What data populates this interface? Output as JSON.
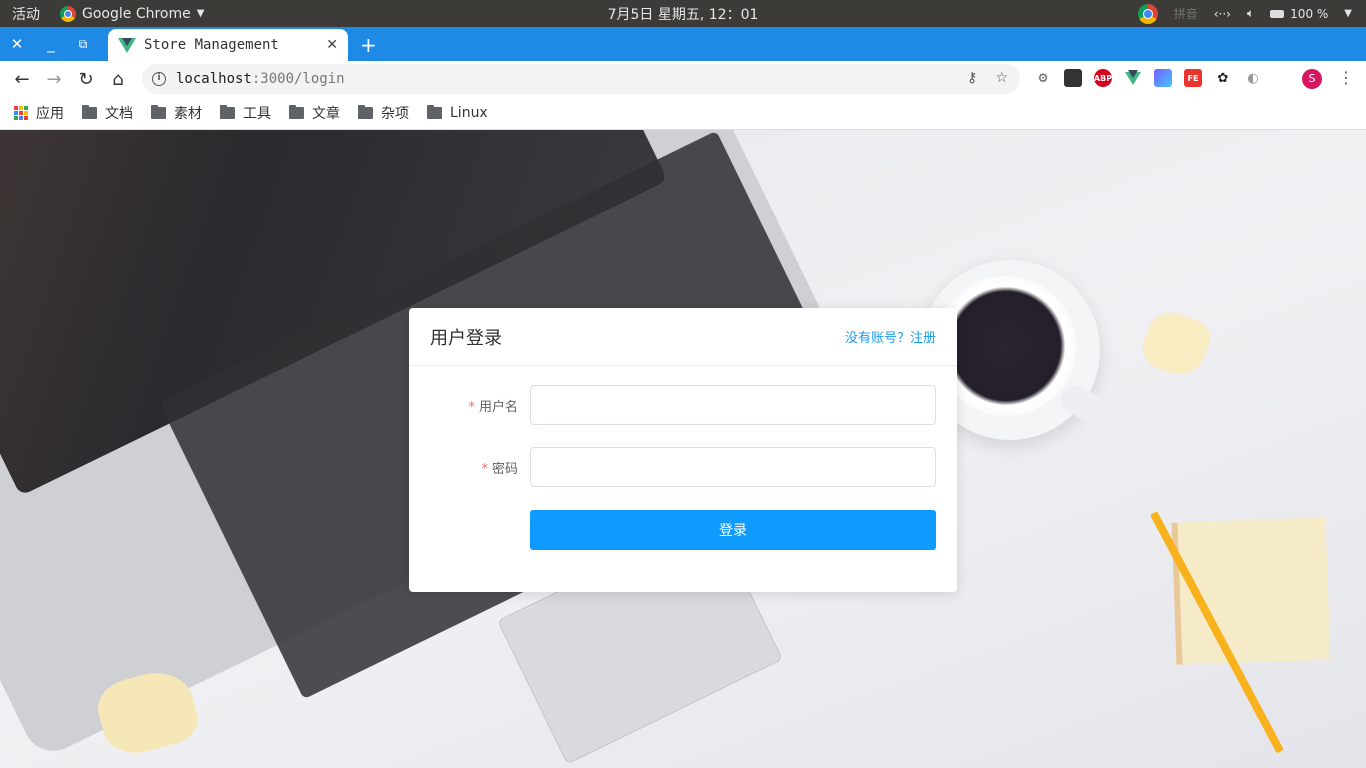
{
  "system_bar": {
    "activities": "活动",
    "app_name": "Google Chrome",
    "clock": "7月5日 星期五, 12：01",
    "battery": "100 %"
  },
  "browser": {
    "tab_title": "Store Management",
    "url_host": "localhost",
    "url_path": ":3000/login",
    "bookmarks": [
      "应用",
      "文档",
      "素材",
      "工具",
      "文章",
      "杂项",
      "Linux"
    ],
    "profile_initial": "S",
    "extensions": [
      {
        "name": "abp-icon",
        "label": "ABP",
        "color": "#d9001d"
      },
      {
        "name": "fe-icon",
        "label": "FE",
        "color": "#e8352e"
      }
    ]
  },
  "login": {
    "title": "用户登录",
    "register_link": "没有账号？注册",
    "username_label": "用户名",
    "password_label": "密码",
    "required_mark": "*",
    "username_value": "",
    "password_value": "",
    "submit_label": "登录"
  },
  "colors": {
    "tab_strip": "#1e8ae6",
    "primary_button": "#0f9bfd",
    "link": "#1b9de6",
    "required": "#f56c6c"
  }
}
